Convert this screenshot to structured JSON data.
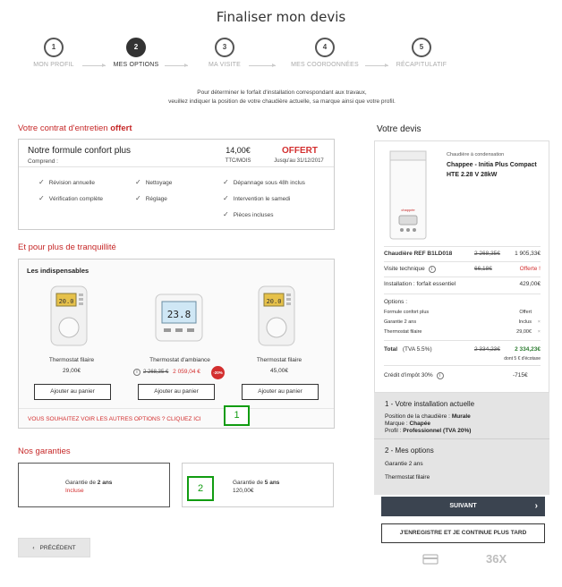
{
  "page_title": "Finaliser mon devis",
  "steps": [
    {
      "num": "1",
      "label": "MON PROFIL"
    },
    {
      "num": "2",
      "label": "MES OPTIONS"
    },
    {
      "num": "3",
      "label": "MA VISITE"
    },
    {
      "num": "4",
      "label": "MES COORDONNÉES"
    },
    {
      "num": "5",
      "label": "RÉCAPITULATIF"
    }
  ],
  "intro_line1": "Pour déterminer le forfait d'installation correspondant aux travaux,",
  "intro_line2": "veuillez indiquer la position de votre chaudière actuelle, sa marque ainsi que votre profil.",
  "contract": {
    "title_prefix": "Votre contrat d'entretien",
    "title_highlight": "offert",
    "formula_name": "Notre formule confort plus",
    "comprend": "Comprend :",
    "price": "14,00€",
    "price_unit": "TTC/MOIS",
    "offer_label": "OFFERT",
    "offer_until": "Jusqu'au 31/12/2017",
    "features": [
      "Révision annuelle",
      "Vérification complète",
      "Nettoyage",
      "Réglage",
      "Dépannage sous 48h inclus",
      "Intervention le samedi",
      "Pièces incluses"
    ]
  },
  "extras": {
    "title": "Et pour plus de tranquillité",
    "subtitle": "Les indispensables",
    "products": [
      {
        "name": "Thermostat filaire",
        "price": "29,00€",
        "button": "Ajouter au panier"
      },
      {
        "name": "Thermostat d'ambiance",
        "old_price": "2 268,35 €",
        "price": "2 059,04 €",
        "discount": "-20%",
        "button": "Ajouter au panier"
      },
      {
        "name": "Thermostat filaire",
        "price": "45,00€",
        "button": "Ajouter au panier"
      }
    ],
    "display_screen": "23.8",
    "more_options_link": "VOUS SOUHAITEZ VOIR LES AUTRES OPTIONS ? CLIQUEZ ICI"
  },
  "guarantees": {
    "title": "Nos garanties",
    "options": [
      {
        "prefix": "Garantie de ",
        "duration": "2 ans",
        "detail": "Incluse"
      },
      {
        "prefix": "Garantie de ",
        "duration": "5 ans",
        "detail": "120,00€"
      }
    ]
  },
  "markers": [
    "1",
    "2"
  ],
  "back_button": "PRÉCÉDENT",
  "quote": {
    "title": "Votre devis",
    "product_category": "Chaudière à condensation",
    "product_name_line1": "Chappee - Initia Plus Compact",
    "product_name_line2": "HTE 2.28 V  28kW",
    "lines": [
      {
        "label": "Chaudière REF B1LD018",
        "old": "2 268,35€",
        "value": "1 905,33€"
      },
      {
        "label": "Visite technique",
        "old": "66,18€",
        "value": "Offerte !"
      },
      {
        "label": "Installation : forfait essentiel",
        "value": "429,00€"
      }
    ],
    "options_label": "Options :",
    "options": [
      {
        "label": "Formule confort plus",
        "value": "Offert"
      },
      {
        "label": "Garantie 2 ans",
        "value": "Inclus"
      },
      {
        "label": "Thermostat filaire",
        "value": "29,00€"
      }
    ],
    "total_label": "Total",
    "total_tax": "(TVA 5.5%)",
    "total_old": "2 334,23€",
    "total_value": "2 334,23€",
    "ecotax": "dont 5 € d'écotaxe",
    "credit_label": "Crédit d'impôt 30%",
    "credit_value": "-715€",
    "installation_title": "1 - Votre installation actuelle",
    "position_label": "Position de la chaudière :",
    "position_value": "Murale",
    "brand_label": "Marque :",
    "brand_value": "Chapée",
    "profile_label": "Profil :",
    "profile_value": "Professionnel (TVA 20%)",
    "options_title": "2 - Mes options",
    "opt1": "Garantie 2 ans",
    "opt2": "Thermostat filaire",
    "next_button": "SUIVANT",
    "save_button": "J'ENREGISTRE ET JE CONTINUE PLUS TARD",
    "footer_text": "36X"
  }
}
